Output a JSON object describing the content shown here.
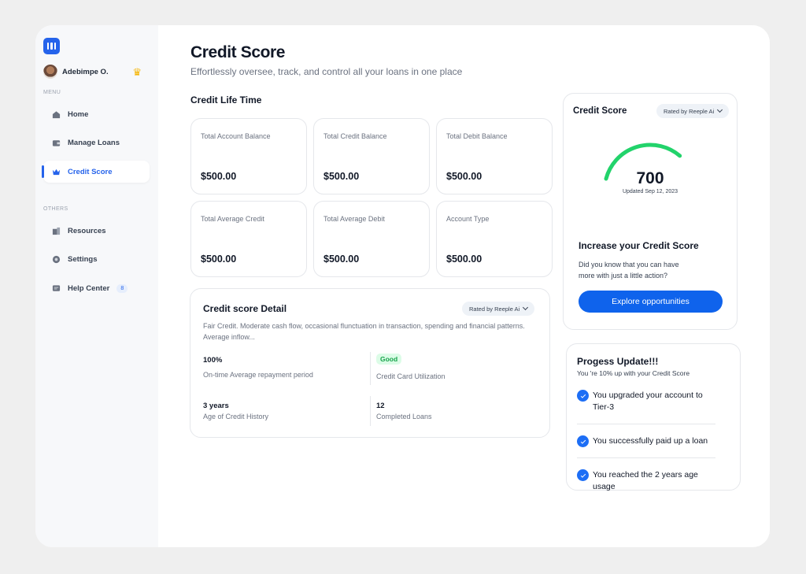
{
  "user": {
    "name": "Adebimpe O."
  },
  "menu": {
    "label": "MENU",
    "items": [
      {
        "label": "Home",
        "icon": "home-icon"
      },
      {
        "label": "Manage Loans",
        "icon": "wallet-icon"
      },
      {
        "label": "Credit Score",
        "icon": "crown-icon",
        "active": true
      }
    ]
  },
  "others": {
    "label": "OTHERS",
    "items": [
      {
        "label": "Resources",
        "icon": "building-icon"
      },
      {
        "label": "Settings",
        "icon": "gear-icon"
      },
      {
        "label": "Help Center",
        "icon": "chat-icon",
        "badge": "8"
      }
    ]
  },
  "header": {
    "title": "Credit Score",
    "subtitle": "Effortlessly oversee, track, and control all your loans in one place"
  },
  "credit_life": {
    "title": "Credit Life Time",
    "cards": [
      {
        "label": "Total Account Balance",
        "value": "$500.00"
      },
      {
        "label": "Total Credit Balance",
        "value": "$500.00"
      },
      {
        "label": "Total Debit Balance",
        "value": "$500.00"
      },
      {
        "label": "Total Average Credit",
        "value": "$500.00"
      },
      {
        "label": "Total Average Debit",
        "value": "$500.00"
      },
      {
        "label": "Account Type",
        "value": "$500.00"
      }
    ]
  },
  "detail": {
    "title": "Credit score Detail",
    "rated_by": "Rated by Reeple Ai",
    "description": "Fair Credit. Moderate cash flow, occasional flunctuation in transaction, spending and financial patterns. Average inflow...",
    "metrics": [
      {
        "value": "100%",
        "label": "On-time Average repayment period"
      },
      {
        "value": "Good",
        "label": "Credit Card Utilization"
      },
      {
        "value": "3 years",
        "label": "Age of Credit History"
      },
      {
        "value": "12",
        "label": "Completed Loans"
      }
    ]
  },
  "score": {
    "title": "Credit Score",
    "rated_by": "Rated by Reeple Ai",
    "value": "700",
    "fraction": 0.7,
    "updated": "Updated Sep 12, 2023",
    "gauge_color": "#22d36b",
    "increase_title": "Increase your Credit Score",
    "increase_desc": "Did you know that you can have more with just a little action?",
    "cta": "Explore opportunities"
  },
  "progress": {
    "title": "Progess Update!!!",
    "subtitle": "You 're 10% up with your Credit Score",
    "items": [
      "You upgraded your account to Tier-3",
      "You successfully paid up a loan",
      "You reached the 2 years age usage"
    ]
  },
  "colors": {
    "accent": "#2563eb",
    "good": "#16a34a"
  }
}
